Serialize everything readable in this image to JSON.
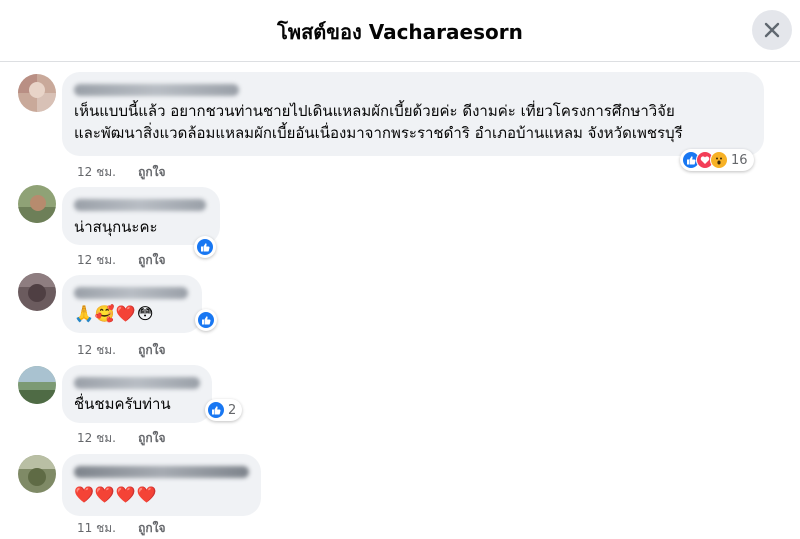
{
  "header": {
    "title": "โพสต์ของ Vacharaesorn"
  },
  "comments": [
    {
      "text": "เห็นแบบนี้แล้ว อยากชวนท่านชายไปเดินแหลมผักเบี้ยด้วยค่ะ ดีงามค่ะ เที่ยวโครงการศึกษาวิจัยและพัฒนาสิ่งแวดล้อมแหลมผักเบี้ยอันเนื่องมาจากพระราชดำริ อำเภอบ้านแหลม จังหวัดเพชรบุรี",
      "line1": "เห็นแบบนี้แล้ว อยากชวนท่านชายไปเดินแหลมผักเบี้ยด้วยค่ะ ดีงามค่ะ เที่ยวโครงการศึกษาวิจัย",
      "line2": "และพัฒนาสิ่งแวดล้อมแหลมผักเบี้ยอันเนื่องมาจากพระราชดำริ อำเภอบ้านแหลม จังหวัดเพชรบุรี",
      "time": "12 ชม.",
      "like": "ถูกใจ",
      "reactions": [
        "like",
        "love",
        "wow"
      ],
      "reaction_count": "16"
    },
    {
      "text": "น่าสนุกนะคะ",
      "time": "12 ชม.",
      "like": "ถูกใจ",
      "reactions": [
        "like"
      ],
      "reaction_count": ""
    },
    {
      "text": "🙏🥰❤️😳",
      "time": "12 ชม.",
      "like": "ถูกใจ",
      "reactions": [
        "like"
      ],
      "reaction_count": ""
    },
    {
      "text": "ชื่นชมครับท่าน",
      "time": "12 ชม.",
      "like": "ถูกใจ",
      "reactions": [
        "like"
      ],
      "reaction_count": "2"
    },
    {
      "text": "❤️❤️❤️❤️",
      "time": "11 ชม.",
      "like": "ถูกใจ",
      "reactions": [],
      "reaction_count": ""
    }
  ],
  "colors": {
    "bubble": "#f0f2f5",
    "like_blue": "#1877f2",
    "love_red": "#f33e58",
    "wow_yellow": "#f7b125",
    "secondary_text": "#65676b"
  }
}
